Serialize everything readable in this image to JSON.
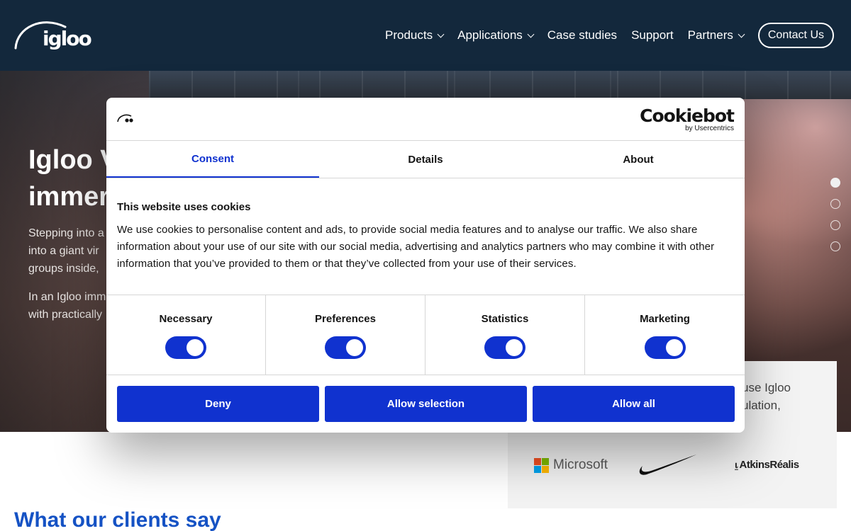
{
  "nav": {
    "logo_text": "igloo",
    "items": [
      {
        "label": "Products",
        "dropdown": true
      },
      {
        "label": "Applications",
        "dropdown": true
      },
      {
        "label": "Case studies",
        "dropdown": false
      },
      {
        "label": "Support",
        "dropdown": false
      },
      {
        "label": "Partners",
        "dropdown": true
      }
    ],
    "contact_label": "Contact Us"
  },
  "hero": {
    "title_line1": "Igloo V",
    "title_line2": "immer",
    "para1_lines": [
      "Stepping into a",
      "into a giant vir",
      "groups inside,"
    ],
    "para2_lines": [
      "In an Igloo imm",
      "with practically"
    ],
    "slides": 4,
    "active_slide": 1
  },
  "clients": {
    "text_lines": [
      "use Igloo",
      "ulation,"
    ],
    "brands": [
      "Microsoft",
      "Nike",
      "AtkinsRéalis"
    ],
    "ms_colors": [
      "#f25022",
      "#7fba00",
      "#00a4ef",
      "#ffb900"
    ]
  },
  "section_title": "What our clients say",
  "cookie": {
    "brand_name": "Cookiebot",
    "brand_sub": "by Usercentrics",
    "tabs": [
      {
        "label": "Consent",
        "active": true
      },
      {
        "label": "Details",
        "active": false
      },
      {
        "label": "About",
        "active": false
      }
    ],
    "heading": "This website uses cookies",
    "body": "We use cookies to personalise content and ads, to provide social media features and to analyse our traffic. We also share information about your use of our site with our social media, advertising and analytics partners who may combine it with other information that you’ve provided to them or that they’ve collected from your use of their services.",
    "categories": [
      {
        "label": "Necessary",
        "enabled": true
      },
      {
        "label": "Preferences",
        "enabled": true
      },
      {
        "label": "Statistics",
        "enabled": true
      },
      {
        "label": "Marketing",
        "enabled": true
      }
    ],
    "buttons": {
      "deny": "Deny",
      "allow_selection": "Allow selection",
      "allow_all": "Allow all"
    },
    "accent_color": "#1032cf"
  }
}
